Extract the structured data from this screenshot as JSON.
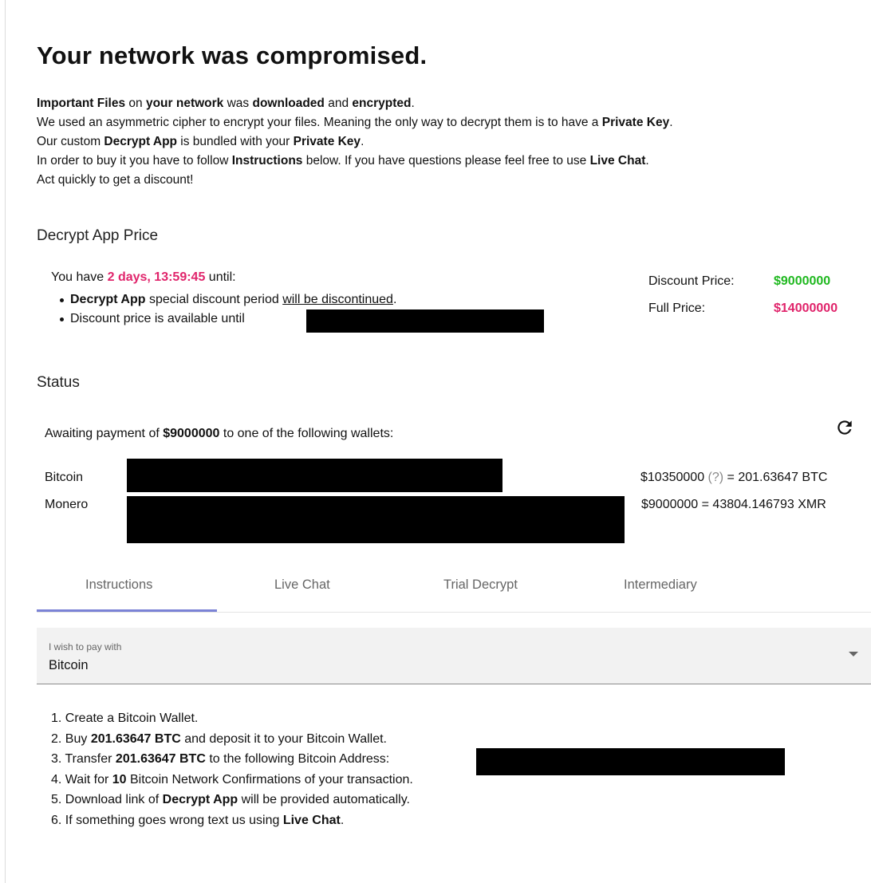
{
  "header": {
    "title": "Your network was compromised."
  },
  "intro": {
    "line1": {
      "p1": "Important Files",
      "p2": " on ",
      "p3": "your network",
      "p4": " was ",
      "p5": "downloaded",
      "p6": " and ",
      "p7": "encrypted",
      "p8": "."
    },
    "line2": {
      "p1": "We used an asymmetric cipher to encrypt your files. Meaning the only way to decrypt them is to have a ",
      "p2": "Private Key",
      "p3": "."
    },
    "line3": {
      "p1": "Our custom ",
      "p2": "Decrypt App",
      "p3": " is bundled with your ",
      "p4": "Private Key",
      "p5": "."
    },
    "line4": {
      "p1": "In order to buy it you have to follow ",
      "p2": "Instructions",
      "p3": " below. If you have questions please feel free to use ",
      "p4": "Live Chat",
      "p5": "."
    },
    "line5": "Act quickly to get a discount!"
  },
  "price_section": {
    "heading": "Decrypt App Price",
    "countdown_prefix": "You have ",
    "countdown": "2 days, 13:59:45",
    "countdown_suffix": " until:",
    "bullet1": {
      "p1": "Decrypt App",
      "p2": " special discount period ",
      "p3": "will be discontinued",
      "p4": "."
    },
    "bullet2": "Discount price is available until ",
    "discount_label": "Discount Price:",
    "discount_value": "$9000000",
    "full_label": "Full Price:",
    "full_value": "$14000000"
  },
  "status_section": {
    "heading": "Status",
    "awaiting_prefix": "Awaiting payment of ",
    "awaiting_amount": "$9000000",
    "awaiting_suffix": " to one of the following wallets:",
    "refresh_icon": "refresh-icon",
    "wallets": [
      {
        "name": "Bitcoin",
        "amount": "$10350000",
        "help": "(?)",
        "conversion": " = 201.63647 BTC"
      },
      {
        "name": "Monero",
        "amount": "$9000000",
        "help": "",
        "conversion": " = 43804.146793 XMR"
      }
    ]
  },
  "tabs": [
    {
      "label": "Instructions",
      "active": true
    },
    {
      "label": "Live Chat",
      "active": false
    },
    {
      "label": "Trial Decrypt",
      "active": false
    },
    {
      "label": "Intermediary",
      "active": false
    }
  ],
  "payment_select": {
    "label": "I wish to pay with",
    "value": "Bitcoin",
    "icon": "dropdown-caret-icon"
  },
  "steps": {
    "s1": "1. Create a Bitcoin Wallet.",
    "s2": {
      "p1": "2. Buy ",
      "p2": "201.63647 BTC",
      "p3": " and deposit it to your Bitcoin Wallet."
    },
    "s3": {
      "p1": "3. Transfer ",
      "p2": "201.63647 BTC",
      "p3": " to the following Bitcoin Address:"
    },
    "s4": {
      "p1": "4. Wait for ",
      "p2": "10",
      "p3": " Bitcoin Network Confirmations of your transaction."
    },
    "s5": {
      "p1": "5. Download link of ",
      "p2": "Decrypt App",
      "p3": " will be provided automatically."
    },
    "s6": {
      "p1": "6. If something goes wrong text us using ",
      "p2": "Live Chat",
      "p3": "."
    }
  },
  "colors": {
    "accent_pink": "#e0246b",
    "discount_green": "#1fb81f",
    "tab_indicator": "#7b83d6"
  }
}
